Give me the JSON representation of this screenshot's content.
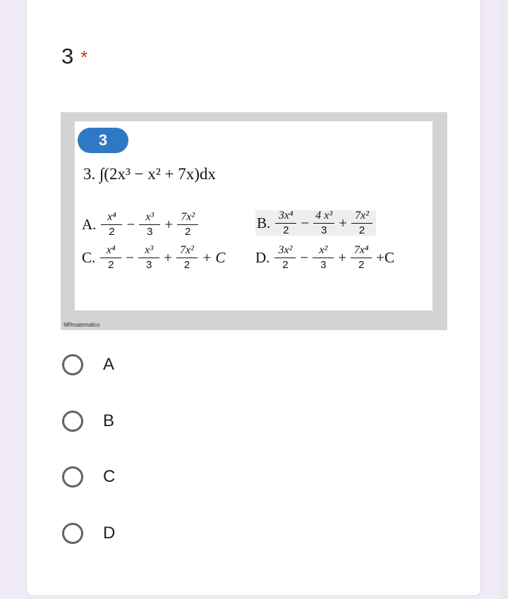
{
  "question": {
    "number": "3",
    "required_mark": "*"
  },
  "image": {
    "badge": "3",
    "problem_text": "3. ∫(2x³ − x² + 7x)dx",
    "watermark": "MRmatematico",
    "options": {
      "A": {
        "letter": "A.",
        "n1": "x⁴",
        "d1": "2",
        "op1": "−",
        "n2": "x³",
        "d2": "3",
        "op2": "+",
        "n3": "7x²",
        "d3": "2",
        "tail": ""
      },
      "B": {
        "letter": "B.",
        "n1": "3x⁴",
        "d1": "2",
        "op1": "−",
        "n2": "4 x³",
        "d2": "3",
        "op2": "+",
        "n3": "7x²",
        "d3": "2",
        "tail": ""
      },
      "C": {
        "letter": "C.",
        "n1": "x⁴",
        "d1": "2",
        "op1": "−",
        "n2": "x³",
        "d2": "3",
        "op2": "+",
        "n3": "7x²",
        "d3": "2",
        "tail": "+ C"
      },
      "D": {
        "letter": "D.",
        "n1": "3x²",
        "d1": "2",
        "op1": "−",
        "n2": "x²",
        "d2": "3",
        "op2": "+",
        "n3": "7x⁴",
        "d3": "2",
        "tail": "+C"
      }
    }
  },
  "choices": [
    "A",
    "B",
    "C",
    "D"
  ],
  "colors": {
    "accent": "#673ab7",
    "required": "#d93025",
    "badge": "#2f78c4"
  }
}
